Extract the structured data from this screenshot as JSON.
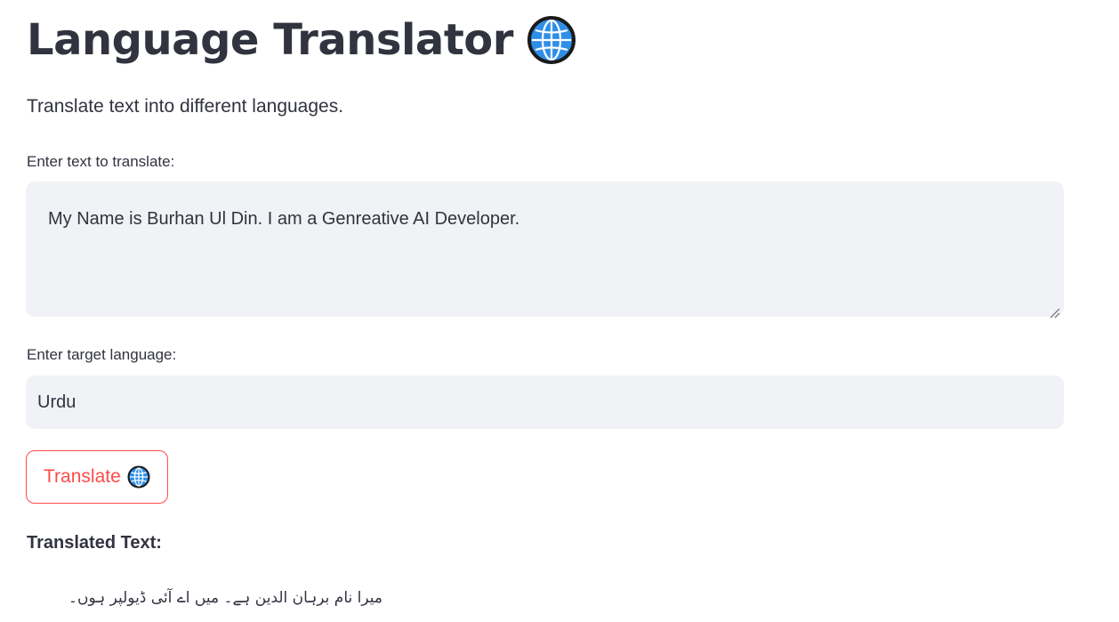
{
  "header": {
    "title": "Language Translator",
    "title_icon": "globe-icon",
    "subtitle": "Translate text into different languages."
  },
  "form": {
    "text_label": "Enter text to translate:",
    "text_value": "My Name is Burhan Ul Din. I am a  Genreative AI Developer.",
    "language_label": "Enter target language:",
    "language_value": "Urdu",
    "button_label": "Translate",
    "button_icon": "globe-icon"
  },
  "result": {
    "heading": "Translated Text:",
    "text": "میرا نام برہان الدین ہے۔ میں اے آئی ڈیولپر ہوں۔"
  },
  "colors": {
    "text": "#31333f",
    "input_bg": "#f0f2f6",
    "accent": "#ff4b4b",
    "globe_blue": "#2f8fe8"
  }
}
